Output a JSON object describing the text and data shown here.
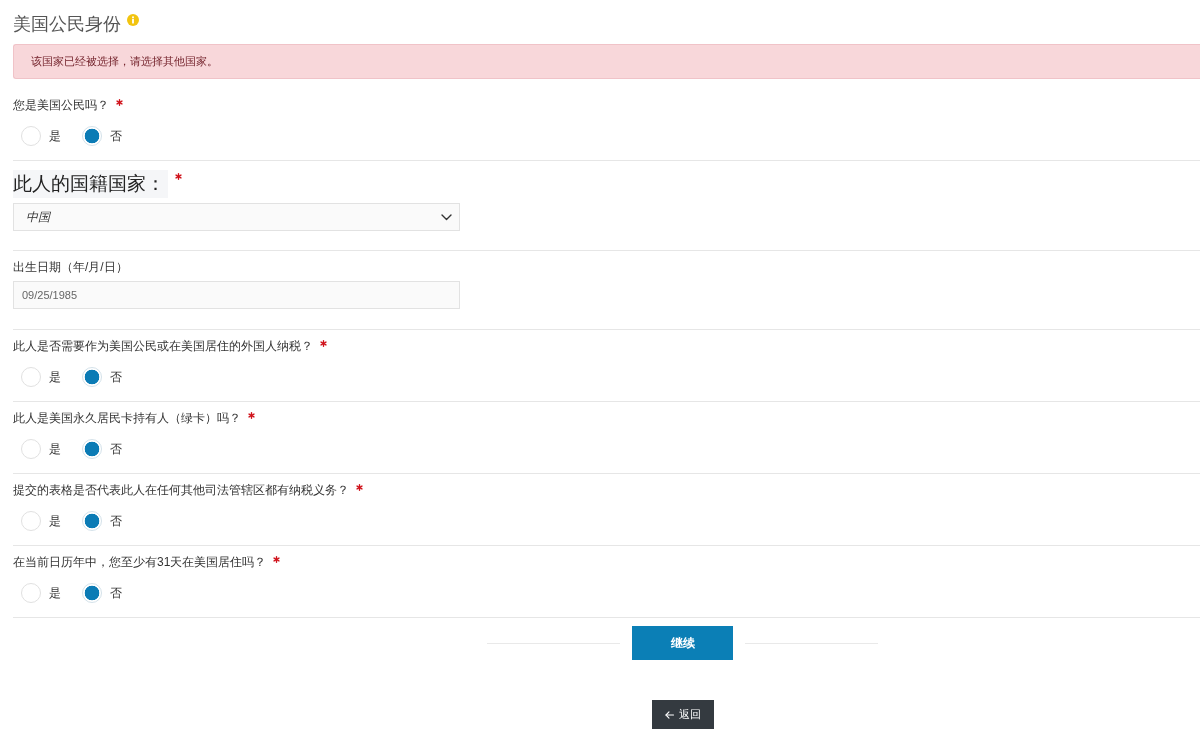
{
  "section": {
    "title": "美国公民身份"
  },
  "alert": {
    "message": "该国家已经被选择，请选择其他国家。"
  },
  "fields": [
    {
      "kind": "radio",
      "label": "您是美国公民吗？",
      "required": true,
      "options": [
        {
          "label": "是",
          "selected": false
        },
        {
          "label": "否",
          "selected": true
        }
      ]
    },
    {
      "kind": "select",
      "label": "此人的国籍国家：",
      "required": true,
      "value": "中国"
    },
    {
      "kind": "text",
      "label": "出生日期（年/月/日）",
      "required": false,
      "value": "09/25/1985"
    },
    {
      "kind": "radio",
      "label": "此人是否需要作为美国公民或在美国居住的外国人纳税？",
      "required": true,
      "options": [
        {
          "label": "是",
          "selected": false
        },
        {
          "label": "否",
          "selected": true
        }
      ]
    },
    {
      "kind": "radio",
      "label": "此人是美国永久居民卡持有人（绿卡）吗？",
      "required": true,
      "options": [
        {
          "label": "是",
          "selected": false
        },
        {
          "label": "否",
          "selected": true
        }
      ]
    },
    {
      "kind": "radio",
      "label": "提交的表格是否代表此人在任何其他司法管辖区都有纳税义务？",
      "required": true,
      "options": [
        {
          "label": "是",
          "selected": false
        },
        {
          "label": "否",
          "selected": true
        }
      ]
    },
    {
      "kind": "radio",
      "label": "在当前日历年中，您至少有31天在美国居住吗？",
      "required": true,
      "options": [
        {
          "label": "是",
          "selected": false
        },
        {
          "label": "否",
          "selected": true
        }
      ]
    }
  ],
  "buttons": [
    {
      "kind": "primary",
      "label": "继续"
    },
    {
      "kind": "back",
      "label": "返回"
    }
  ]
}
